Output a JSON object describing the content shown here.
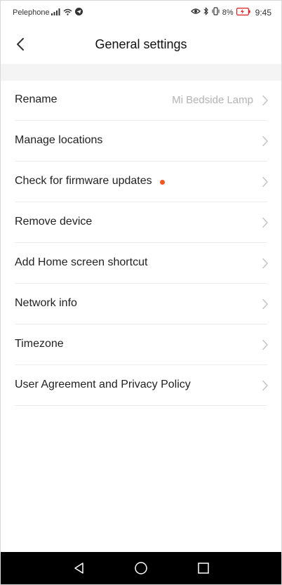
{
  "status_bar": {
    "carrier": "Pelephone",
    "battery_percent": "8%",
    "time": "9:45",
    "icons": [
      "signal-icon",
      "wifi-icon",
      "telegram-icon",
      "eye-icon",
      "bluetooth-icon",
      "vibrate-icon",
      "battery-icon"
    ]
  },
  "header": {
    "title": "General settings",
    "back_icon": "chevron-left-icon"
  },
  "colors": {
    "accent_dot": "#f05a22",
    "nav_bar": "#000000",
    "chevron": "#c4c4c4",
    "battery_low": "#e02020"
  },
  "settings": [
    {
      "label": "Rename",
      "value": "Mi Bedside Lamp"
    },
    {
      "label": "Manage locations"
    },
    {
      "label": "Check for firmware updates",
      "has_update_dot": true
    },
    {
      "label": "Remove device"
    },
    {
      "label": "Add Home screen shortcut"
    },
    {
      "label": "Network info"
    },
    {
      "label": "Timezone"
    },
    {
      "label": "User Agreement and Privacy Policy"
    }
  ],
  "nav_bar": {
    "buttons": [
      "back-triangle-icon",
      "home-circle-icon",
      "recents-square-icon"
    ]
  }
}
